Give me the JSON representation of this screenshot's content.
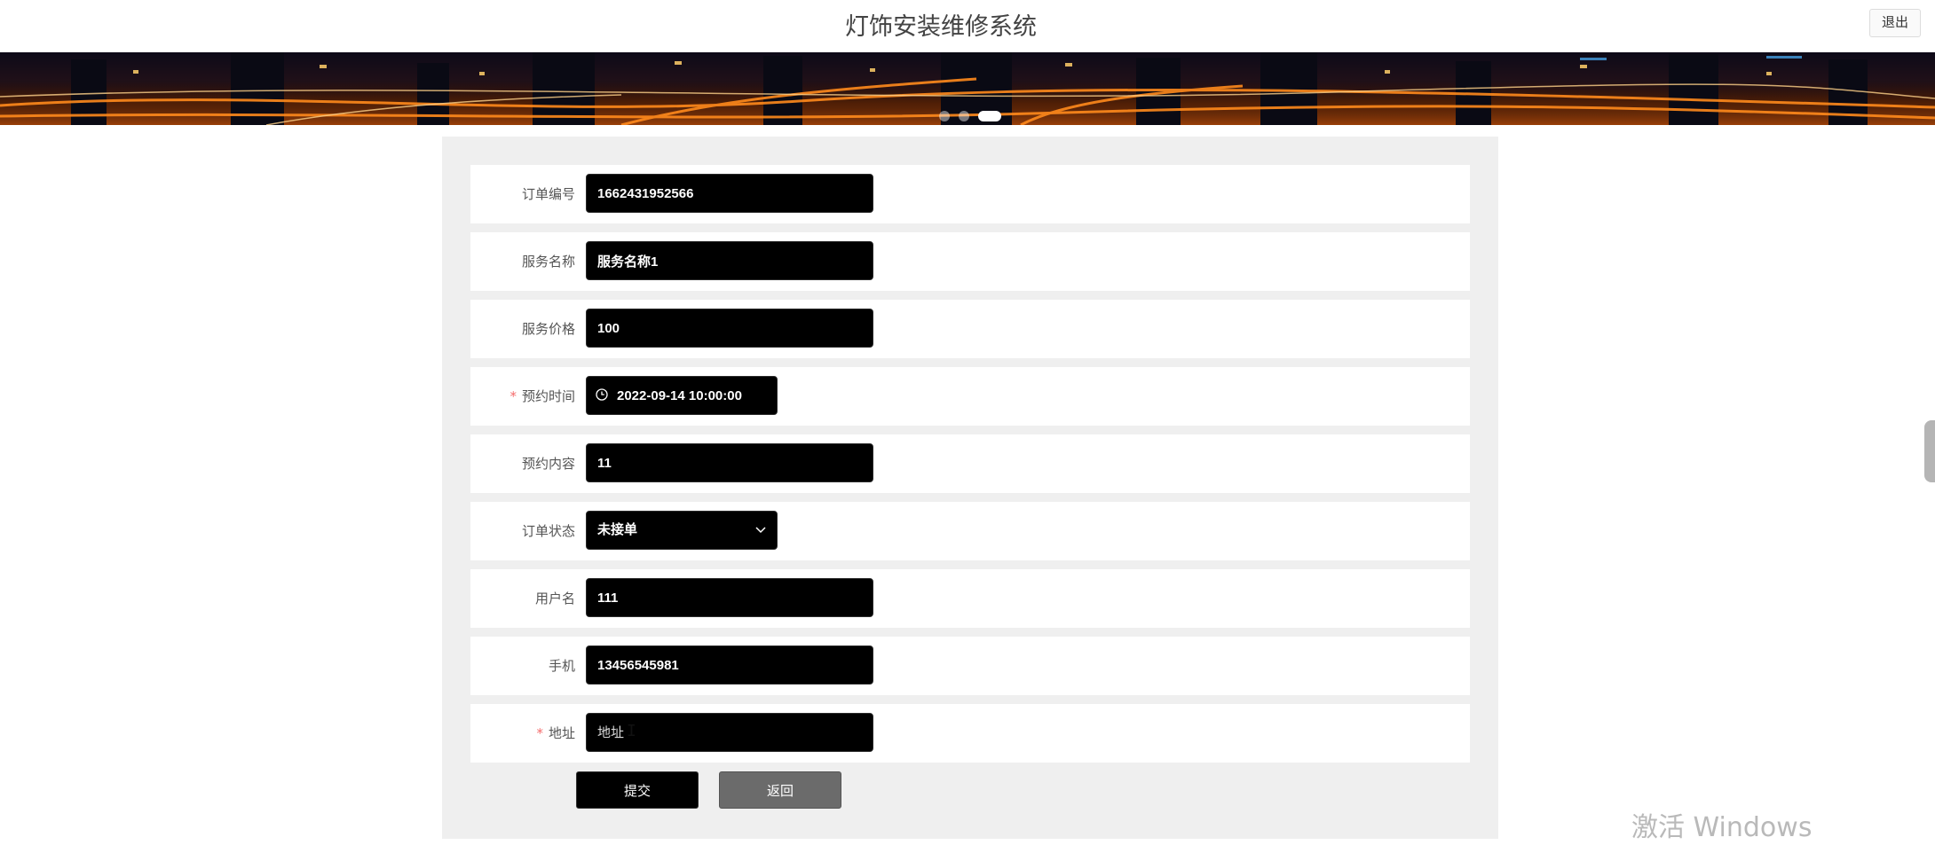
{
  "header": {
    "title": "灯饰安装维修系统",
    "logout_label": "退出"
  },
  "form": {
    "fields": [
      {
        "label": "订单编号",
        "value": "1662431952566",
        "required": false
      },
      {
        "label": "服务名称",
        "value": "服务名称1",
        "required": false
      },
      {
        "label": "服务价格",
        "value": "100",
        "required": false
      },
      {
        "label": "预约时间",
        "value": "2022-09-14 10:00:00",
        "required": true
      },
      {
        "label": "预约内容",
        "value": "11",
        "required": false
      },
      {
        "label": "订单状态",
        "value": "未接单",
        "required": false
      },
      {
        "label": "用户名",
        "value": "111",
        "required": false
      },
      {
        "label": "手机",
        "value": "13456545981",
        "required": false
      },
      {
        "label": "地址",
        "value": "",
        "placeholder": "地址",
        "required": true
      }
    ],
    "required_mark": "*",
    "submit_label": "提交",
    "back_label": "返回"
  },
  "os_watermark": "激活 Windows",
  "colors": {
    "input_bg": "#000000",
    "panel_bg": "#efefef",
    "required": "#f56c6c",
    "back_button": "#6b6b6b"
  },
  "icons": [
    "clock-icon",
    "chevron-down-icon",
    "text-cursor-icon"
  ]
}
